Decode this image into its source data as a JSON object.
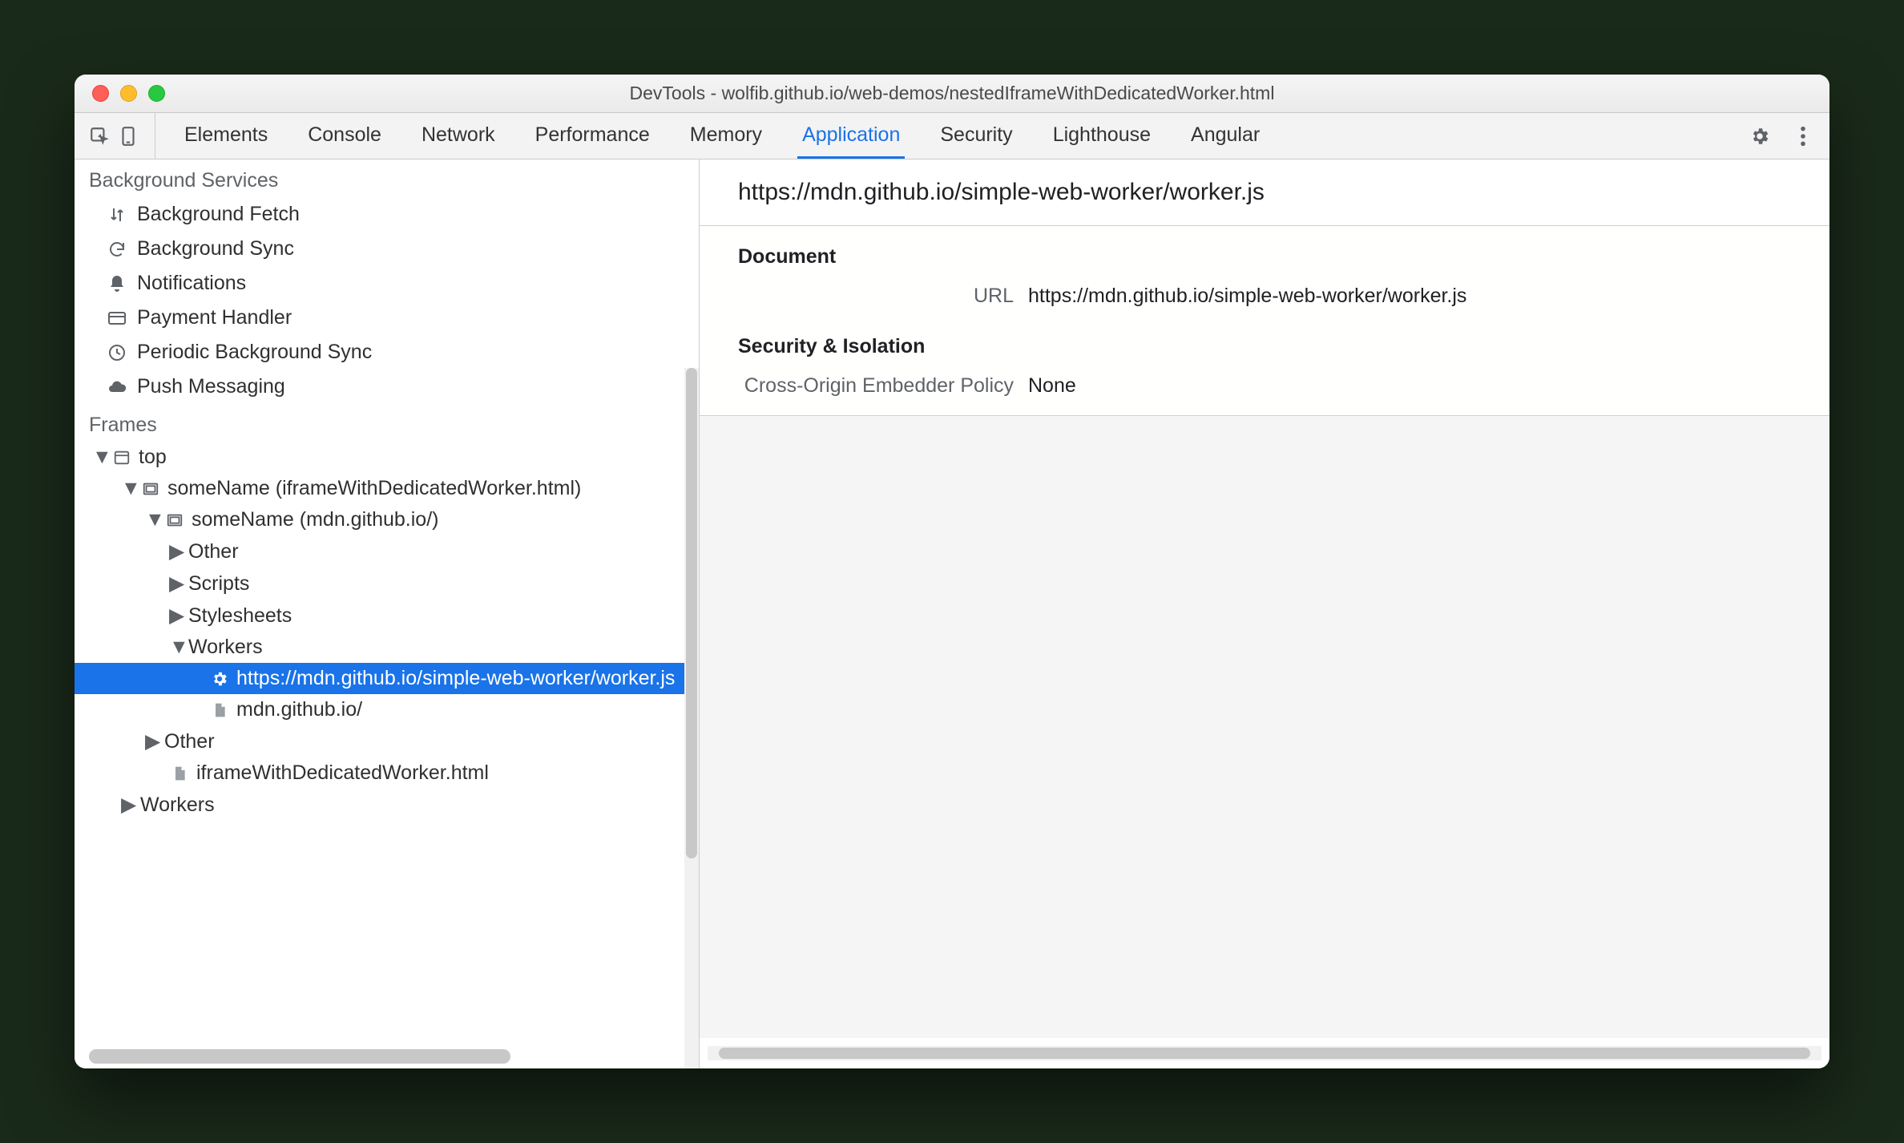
{
  "window": {
    "title": "DevTools - wolfib.github.io/web-demos/nestedIframeWithDedicatedWorker.html"
  },
  "tabs": {
    "elements": "Elements",
    "console": "Console",
    "network": "Network",
    "performance": "Performance",
    "memory": "Memory",
    "application": "Application",
    "security": "Security",
    "lighthouse": "Lighthouse",
    "angular": "Angular"
  },
  "sidebar": {
    "bg_services": "Background Services",
    "services": {
      "fetch": "Background Fetch",
      "sync": "Background Sync",
      "notif": "Notifications",
      "payment": "Payment Handler",
      "periodic": "Periodic Background Sync",
      "push": "Push Messaging"
    },
    "frames_h": "Frames",
    "tree": {
      "top": "top",
      "frame1": "someName (iframeWithDedicatedWorker.html)",
      "frame2": "someName (mdn.github.io/)",
      "other": "Other",
      "scripts": "Scripts",
      "stylesheets": "Stylesheets",
      "workers": "Workers",
      "worker_url": "https://mdn.github.io/simple-web-worker/worker.js",
      "doc1": "mdn.github.io/",
      "other2": "Other",
      "doc2": "iframeWithDedicatedWorker.html",
      "workers2": "Workers"
    }
  },
  "detail": {
    "header": "https://mdn.github.io/simple-web-worker/worker.js",
    "doc_h": "Document",
    "url_k": "URL",
    "url_v": "https://mdn.github.io/simple-web-worker/worker.js",
    "sec_h": "Security & Isolation",
    "coep_k": "Cross-Origin Embedder Policy",
    "coep_v": "None"
  }
}
